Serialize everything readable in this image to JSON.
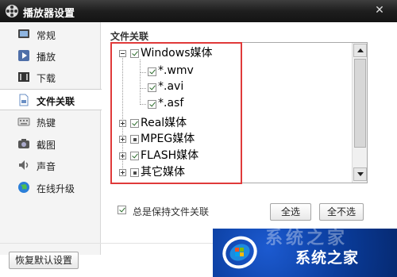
{
  "window": {
    "title": "播放器设置",
    "close_label": "✕"
  },
  "sidebar": {
    "items": [
      {
        "label": "常规",
        "icon": "display-icon"
      },
      {
        "label": "播放",
        "icon": "play-icon"
      },
      {
        "label": "下载",
        "icon": "download-icon"
      },
      {
        "label": "文件关联",
        "icon": "file-icon",
        "active": true
      },
      {
        "label": "热键",
        "icon": "keyboard-icon"
      },
      {
        "label": "截图",
        "icon": "camera-icon"
      },
      {
        "label": "声音",
        "icon": "speaker-icon"
      },
      {
        "label": "在线升级",
        "icon": "globe-icon"
      }
    ]
  },
  "main": {
    "section_title": "文件关联",
    "tree": [
      {
        "label": "Windows媒体",
        "expanded": true,
        "state": "checked",
        "children": [
          {
            "label": "*.wmv",
            "state": "checked"
          },
          {
            "label": "*.avi",
            "state": "checked"
          },
          {
            "label": "*.asf",
            "state": "checked"
          }
        ]
      },
      {
        "label": "Real媒体",
        "expanded": false,
        "state": "checked"
      },
      {
        "label": "MPEG媒体",
        "expanded": false,
        "state": "partial"
      },
      {
        "label": "FLASH媒体",
        "expanded": false,
        "state": "checked"
      },
      {
        "label": "其它媒体",
        "expanded": false,
        "state": "partial"
      }
    ],
    "keep_association": {
      "label": "总是保持文件关联",
      "checked": true
    },
    "select_all_label": "全选",
    "select_none_label": "全不选"
  },
  "footer": {
    "restore_defaults_label": "恢复默认设置"
  },
  "watermark": {
    "text": "系统之家",
    "ghost_text": "系统之家"
  },
  "colors": {
    "highlight_box": "#e03a3a",
    "titlebar": "#1e1e1e",
    "watermark_bg": "#0a3c9b"
  }
}
